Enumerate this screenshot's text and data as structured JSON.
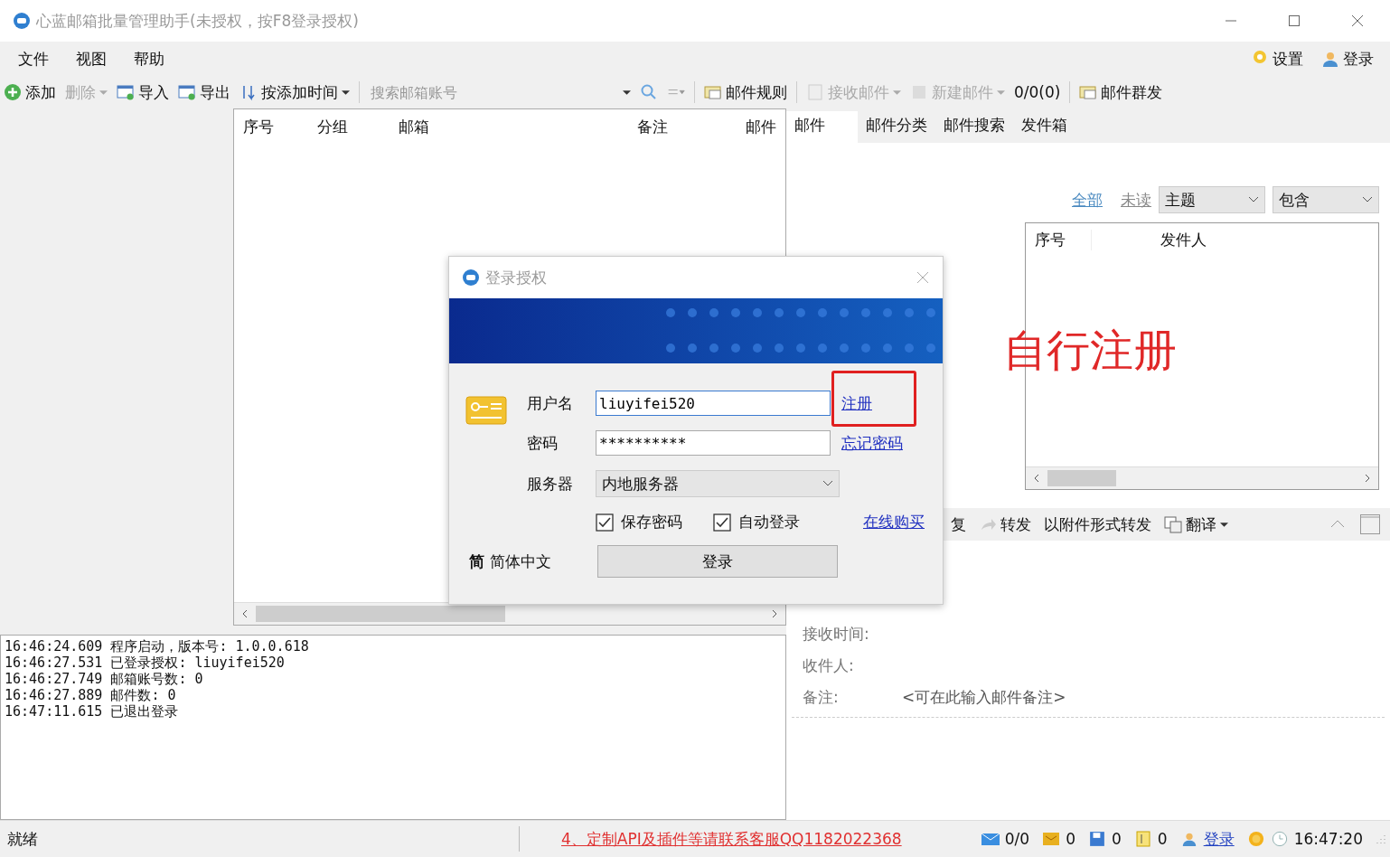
{
  "window": {
    "title": "心蓝邮箱批量管理助手(未授权，按F8登录授权)"
  },
  "menu": [
    "文件",
    "视图",
    "帮助"
  ],
  "menu_right": [
    "设置",
    "登录"
  ],
  "toolbar": [
    {
      "label": "添加",
      "disabled": false,
      "dropdown": false
    },
    {
      "label": "删除",
      "disabled": true,
      "dropdown": true
    },
    {
      "label": "导入",
      "disabled": false,
      "dropdown": false
    },
    {
      "label": "导出",
      "disabled": false,
      "dropdown": false
    },
    {
      "label": "按添加时间",
      "disabled": false,
      "dropdown": true
    }
  ],
  "search": {
    "placeholder": "搜索邮箱账号"
  },
  "toolbar_right": [
    {
      "label": "邮件规则",
      "disabled": false,
      "dropdown": false
    },
    {
      "label": "接收邮件",
      "disabled": true,
      "dropdown": true
    },
    {
      "label": "新建邮件",
      "disabled": true,
      "dropdown": true
    },
    {
      "label": "0/0(0)",
      "disabled": false,
      "dropdown": false
    },
    {
      "label": "邮件群发",
      "disabled": false,
      "dropdown": false
    }
  ],
  "account_table": {
    "columns": [
      "序号",
      "分组",
      "邮箱",
      "备注",
      "邮件"
    ]
  },
  "log": [
    "16:46:24.609 程序启动，版本号: 1.0.0.618",
    "16:46:27.531 已登录授权: liuyifei520",
    "16:46:27.749 邮箱账号数: 0",
    "16:46:27.889 邮件数: 0",
    "16:47:11.615 已退出登录"
  ],
  "mail_tabs": [
    {
      "label": "邮件",
      "selected": true
    },
    {
      "label": "邮件分类",
      "selected": false
    },
    {
      "label": "邮件搜索",
      "selected": false
    },
    {
      "label": "发件箱",
      "selected": false
    }
  ],
  "filters": [
    {
      "label": "全部",
      "selected": true
    },
    {
      "label": "未读",
      "selected": false
    }
  ],
  "filter_field": {
    "value": "主题"
  },
  "filter_op": {
    "value": "包含"
  },
  "mail_table": {
    "columns": [
      "序号",
      "",
      "发件人"
    ]
  },
  "reader_toolbar": [
    {
      "label": "复",
      "dropdown": false
    },
    {
      "label": "转发",
      "dropdown": false
    },
    {
      "label": "以附件形式转发",
      "dropdown": false
    },
    {
      "label": "翻译",
      "dropdown": true
    }
  ],
  "mail_fields": [
    {
      "label": "接收时间:"
    },
    {
      "label": "收件人:"
    },
    {
      "label": "备注:",
      "value": "<可在此输入邮件备注>"
    }
  ],
  "status_bar": {
    "state": "就绪",
    "notice": "4、定制API及插件等请联系客服QQ1182022368",
    "counts": [
      "0/0",
      "0",
      "0",
      "0"
    ],
    "login": "登录",
    "time": "16:47:20"
  },
  "dialog": {
    "title": "登录授权",
    "username_label": "用户名",
    "username": "liuyifei520",
    "password_label": "密码",
    "password": "**********",
    "server_label": "服务器",
    "server": "内地服务器",
    "register": "注册",
    "forgot": "忘记密码",
    "buy": "在线购买",
    "options": [
      {
        "label": "保存密码",
        "checked": true
      },
      {
        "label": "自动登录",
        "checked": true
      }
    ],
    "language_icon": "简",
    "language": "简体中文",
    "login": "登录"
  },
  "annotation": {
    "text": "自行注册"
  }
}
